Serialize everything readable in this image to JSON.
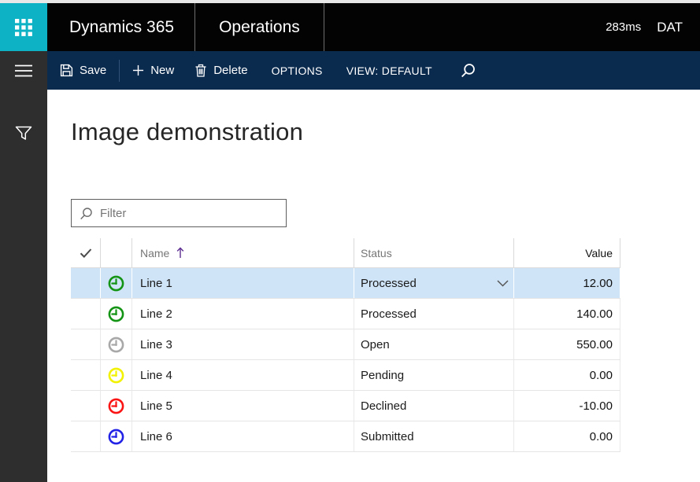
{
  "app_bar": {
    "brand": "Dynamics 365",
    "product": "Operations",
    "latency": "283ms",
    "company": "DAT"
  },
  "toolbar": {
    "save_label": "Save",
    "new_label": "New",
    "delete_label": "Delete",
    "options_label": "OPTIONS",
    "view_label": "VIEW: DEFAULT"
  },
  "page": {
    "title": "Image demonstration"
  },
  "filter": {
    "placeholder": "Filter"
  },
  "grid": {
    "columns": {
      "name": "Name",
      "status": "Status",
      "value": "Value"
    },
    "sort": {
      "column": "Name",
      "direction": "ascending"
    },
    "rows": [
      {
        "name": "Line 1",
        "status": "Processed",
        "value": "12.00",
        "icon": "clock-icon",
        "icon_color": "#149414",
        "selected": true
      },
      {
        "name": "Line 2",
        "status": "Processed",
        "value": "140.00",
        "icon": "clock-icon",
        "icon_color": "#149414",
        "selected": false
      },
      {
        "name": "Line 3",
        "status": "Open",
        "value": "550.00",
        "icon": "clock-icon",
        "icon_color": "#a8a8a8",
        "selected": false
      },
      {
        "name": "Line 4",
        "status": "Pending",
        "value": "0.00",
        "icon": "clock-icon",
        "icon_color": "#f2f200",
        "selected": false
      },
      {
        "name": "Line 5",
        "status": "Declined",
        "value": "-10.00",
        "icon": "clock-icon",
        "icon_color": "#fa1414",
        "selected": false
      },
      {
        "name": "Line 6",
        "status": "Submitted",
        "value": "0.00",
        "icon": "clock-icon",
        "icon_color": "#2222e6",
        "selected": false
      }
    ]
  },
  "colors": {
    "accent_teal": "#0db2c4",
    "command_bar_navy": "#0a2a4e",
    "top_bar_black": "#030303",
    "sidebar_gray": "#2e2e2e",
    "selected_row_blue": "#cfe4f7",
    "sort_arrow_purple": "#5c2d91"
  }
}
